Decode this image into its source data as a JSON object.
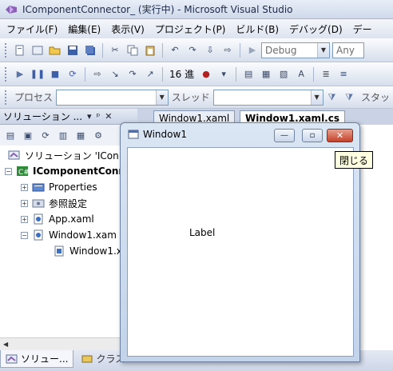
{
  "vs_window": {
    "title": "IComponentConnector_ (実行中) - Microsoft Visual Studio"
  },
  "menu": [
    "ファイル(F)",
    "編集(E)",
    "表示(V)",
    "プロジェクト(P)",
    "ビルド(B)",
    "デバッグ(D)",
    "デー"
  ],
  "toolbar1": {
    "config_combo": "Debug",
    "platform_combo": "Any"
  },
  "toolbar2": {
    "hex_value": "16 進"
  },
  "toolbar3": {
    "process_label": "プロセス",
    "thread_label": "スレッド",
    "stack_label": "スタッ"
  },
  "solution_explorer": {
    "header": "ソリューション ...",
    "pin_glyph": "ᵖ",
    "close_glyph": "✕",
    "dropdown_glyph": "▾",
    "tree": [
      {
        "label": "ソリューション 'ICon",
        "level": 0,
        "expander": "",
        "bold": false
      },
      {
        "label": "IComponentConr",
        "level": 1,
        "expander": "−",
        "bold": true
      },
      {
        "label": "Properties",
        "level": 2,
        "expander": "+",
        "bold": false
      },
      {
        "label": "参照設定",
        "level": 2,
        "expander": "+",
        "bold": false
      },
      {
        "label": "App.xaml",
        "level": 2,
        "expander": "+",
        "bold": false
      },
      {
        "label": "Window1.xam",
        "level": 2,
        "expander": "−",
        "bold": false
      },
      {
        "label": "Window1.x",
        "level": 3,
        "expander": "",
        "bold": false
      }
    ]
  },
  "bottom_tabs": [
    "ソリュー...",
    "クラス ..."
  ],
  "editor_tabs": [
    {
      "label": "Window1.xaml",
      "active": false
    },
    {
      "label": "Window1.xaml.cs",
      "active": true
    }
  ],
  "app_window": {
    "title": "Window1",
    "label_text": "Label",
    "minimize_glyph": "—",
    "maximize_glyph": "▫",
    "close_glyph": "✕"
  },
  "tooltip": {
    "text": "閉じる"
  },
  "colors": {
    "close_button": "#c4412a",
    "tooltip_bg": "#ffffe1",
    "chrome": "#d4dbe8"
  }
}
